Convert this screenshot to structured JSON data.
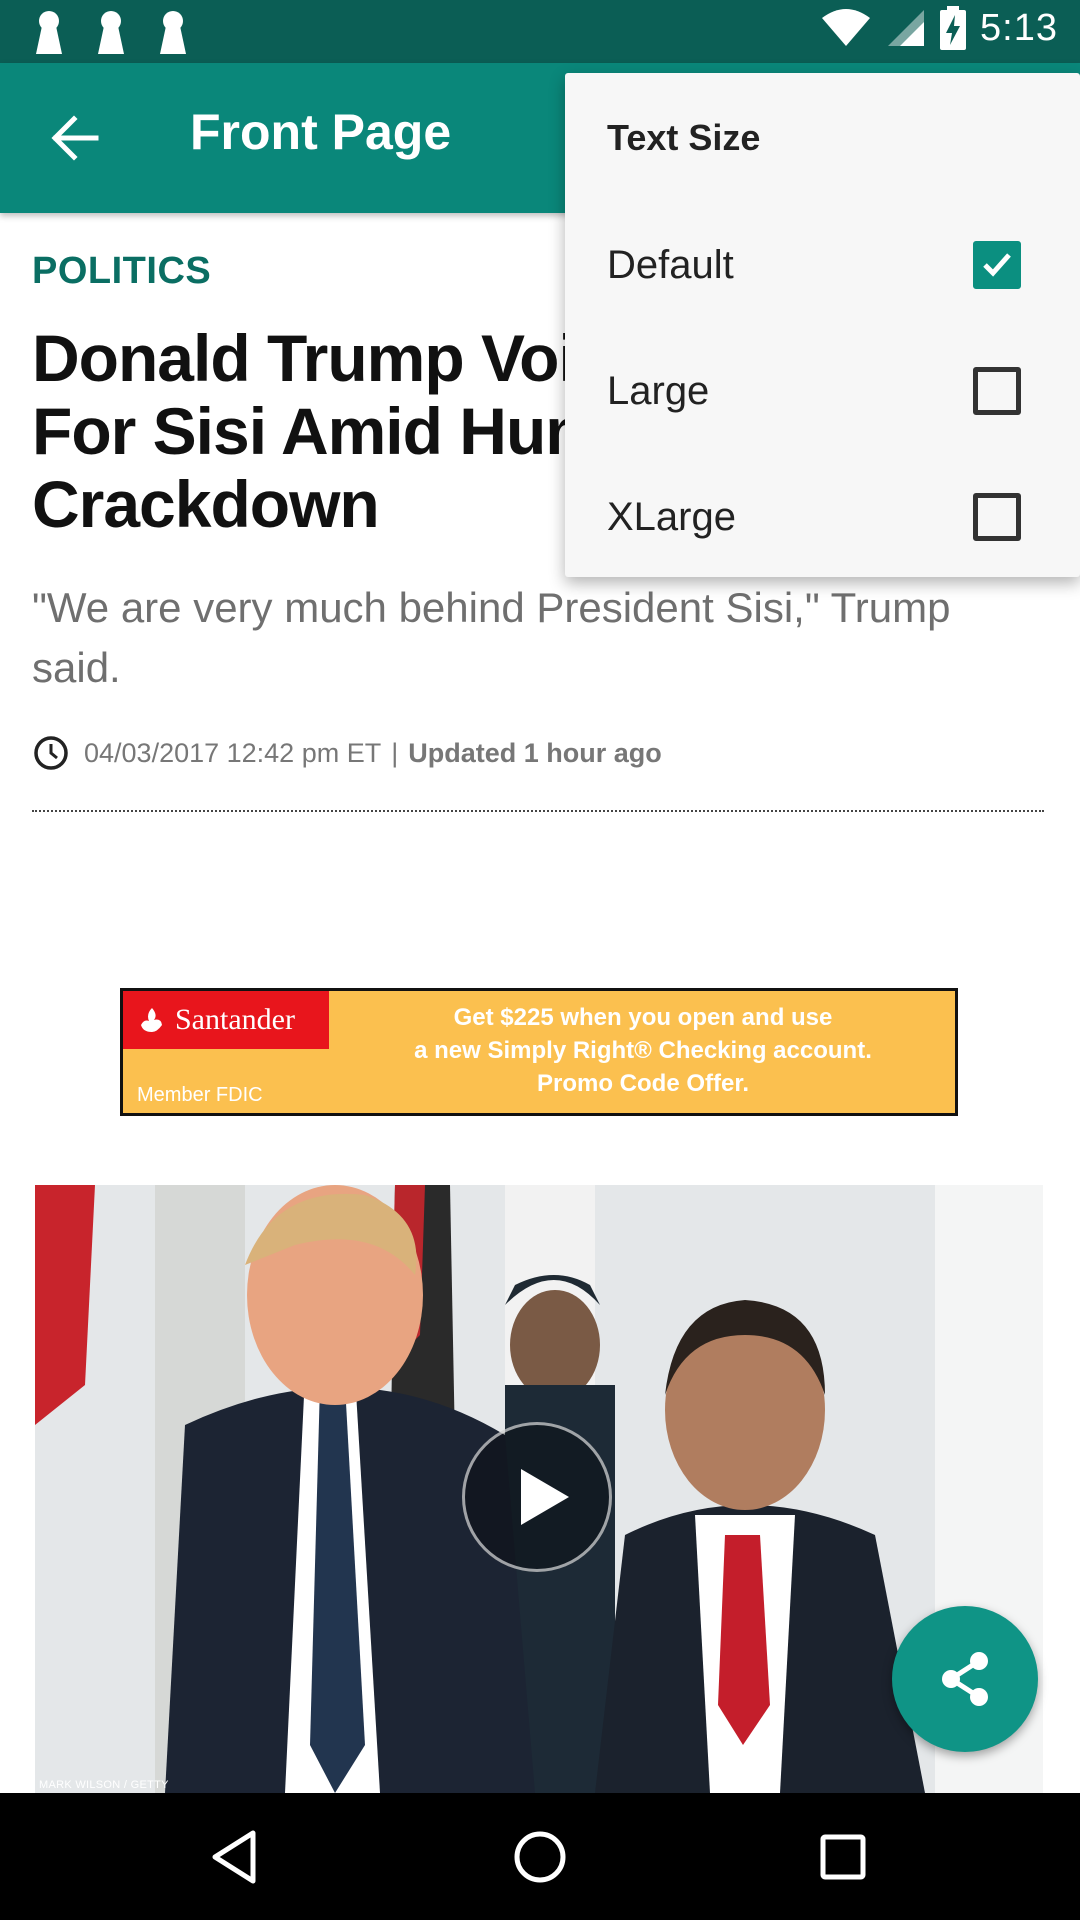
{
  "status_bar": {
    "time": "5:13",
    "icons": [
      "keyhole-icon",
      "keyhole-icon",
      "keyhole-icon",
      "wifi-icon",
      "cell-signal-icon",
      "battery-charging-icon"
    ]
  },
  "app_bar": {
    "title": "Front Page",
    "back_icon": "arrow-left-icon"
  },
  "article": {
    "category": "POLITICS",
    "headline": "Donald Trump Voices Support For Sisi Amid Human Rights Crackdown",
    "dek": "\"We are very much behind President Sisi,\" Trump said.",
    "date": "04/03/2017 12:42 pm ET",
    "separator": "|",
    "updated": "Updated 1 hour ago",
    "photo_credit": "MARK WILSON / GETTY"
  },
  "ad": {
    "brand": "Santander",
    "member": "Member FDIC",
    "line1": "Get $225 when you open and use",
    "line2": "a new Simply Right® Checking account.",
    "line3": "Promo Code Offer."
  },
  "menu": {
    "title": "Text Size",
    "items": [
      {
        "label": "Default",
        "checked": true
      },
      {
        "label": "Large",
        "checked": false
      },
      {
        "label": "XLarge",
        "checked": false
      }
    ]
  },
  "colors": {
    "status_bar": "#0b5e55",
    "app_bar": "#0a877a",
    "accent": "#0b8f80",
    "ad_background": "#fbc04f",
    "ad_brand": "#e8151c"
  }
}
